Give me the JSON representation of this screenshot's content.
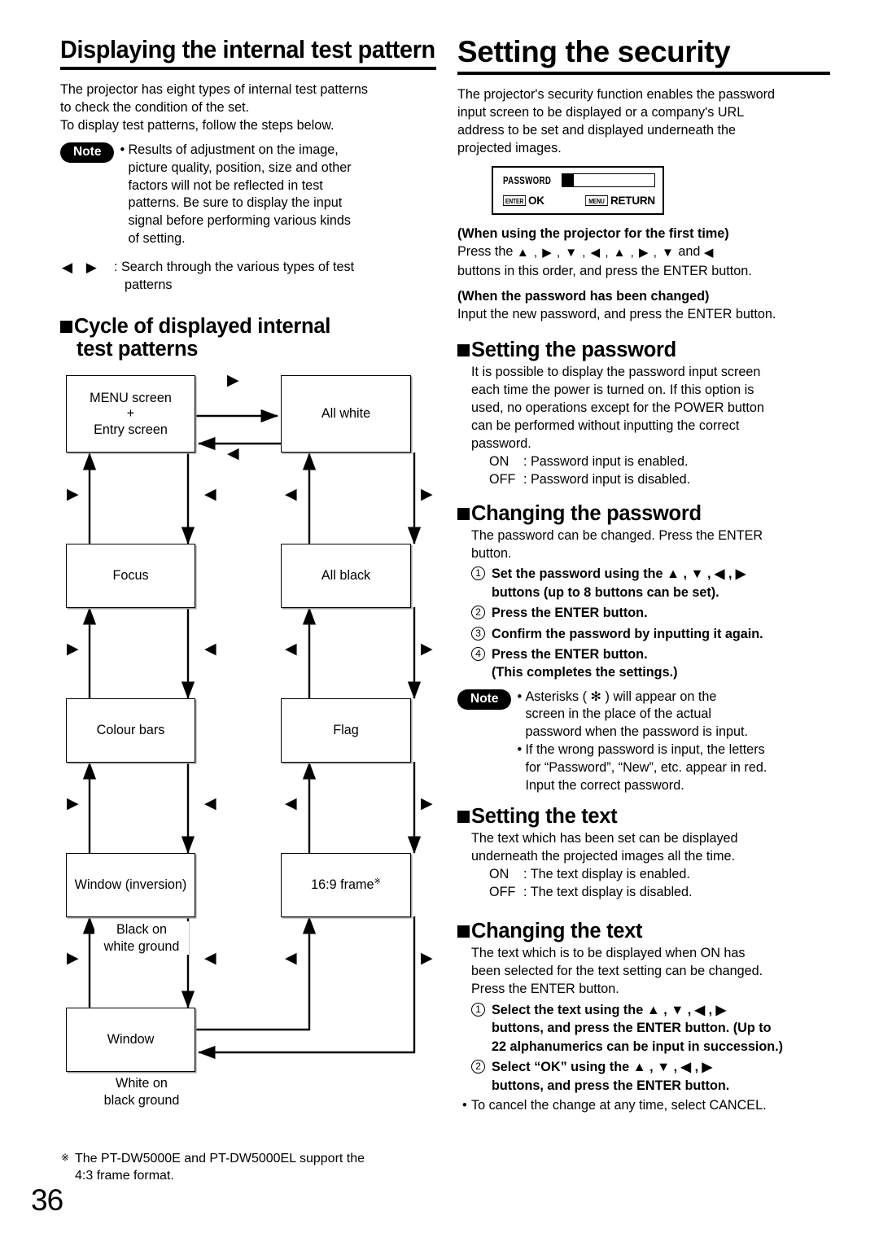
{
  "page_number": "36",
  "left_column": {
    "chapter_title": "Displaying the internal test pattern",
    "intro": [
      "The projector has eight types of internal test patterns",
      "to check the condition of the set.",
      "To display test patterns, follow the steps below."
    ],
    "note": {
      "badge": "Note",
      "bullet": "•",
      "items": [
        "Results of adjustment on the image,",
        "picture quality, position, size and other",
        "factors will not be reflected in test",
        "patterns. Be sure to display the input",
        "signal before performing various kinds",
        "of setting."
      ]
    },
    "legend": {
      "triangles": "◀ ▶",
      "line1": ": Search through the various types of test",
      "line2": "patterns"
    },
    "section_title_line1": "Cycle of displayed internal",
    "section_title_line2": "test patterns",
    "flow": {
      "boxes": [
        {
          "id": "menu",
          "label": "MENU screen\n+\nEntry screen"
        },
        {
          "id": "all-white",
          "label": "All white"
        },
        {
          "id": "focus",
          "label": "Focus"
        },
        {
          "id": "all-black",
          "label": "All black"
        },
        {
          "id": "colour-bars",
          "label": "Colour bars"
        },
        {
          "id": "flag",
          "label": "Flag"
        },
        {
          "id": "window-inversion",
          "label": "Window (inversion)"
        },
        {
          "id": "frame-16-9",
          "label": "16:9 frame",
          "sup": "※"
        },
        {
          "id": "window",
          "label": "Window"
        }
      ],
      "caption_black_on_white_l1": "Black on",
      "caption_black_on_white_l2": "white ground",
      "caption_white_on_black_l1": "White on",
      "caption_white_on_black_l2": "black ground",
      "tri_right": "▶",
      "tri_left": "◀"
    },
    "footnote": {
      "mark": "※",
      "line1": "The PT-DW5000E and PT-DW5000EL support the",
      "line2": "4:3 frame format."
    }
  },
  "right_column": {
    "chapter_title": "Setting the security",
    "intro": [
      "The projector's security function enables the password",
      "input screen to be displayed or a company's URL",
      "address to be set and displayed underneath the",
      "projected images."
    ],
    "osd": {
      "label": "PASSWORD",
      "enter_key": "ENTER",
      "enter_action": "OK",
      "menu_key": "MENU",
      "menu_action": "RETURN"
    },
    "first_time": {
      "heading": "(When using the projector for the first time)",
      "press_the": "Press the",
      "sequence": "▲ , ▶ , ▼ , ◀ , ▲ , ▶ , ▼",
      "and": "and",
      "last_button": "◀",
      "line2": "buttons in this order, and press the ENTER button."
    },
    "changed": {
      "heading": "(When the password has been changed)",
      "line1": "Input the new password, and press the ENTER button."
    },
    "setting_password": {
      "title": "Setting the password",
      "body": [
        "It is possible to display the password input screen",
        "each time the power is turned on. If this option is",
        "used, no operations except for the POWER button",
        "can be performed without inputting the correct",
        "password."
      ],
      "on_key": "ON",
      "on_val": ": Password input is enabled.",
      "off_key": "OFF",
      "off_val": ": Password input is disabled."
    },
    "changing_password": {
      "title": "Changing the password",
      "body": [
        "The password can be changed. Press the ENTER",
        "button."
      ],
      "steps": [
        {
          "num": "1",
          "line1": "Set the password using the ▲ , ▼ , ◀ , ▶",
          "line2": "buttons (up to 8 buttons can be set)."
        },
        {
          "num": "2",
          "line1": "Press the ENTER button.",
          "line2": ""
        },
        {
          "num": "3",
          "line1": "Confirm the password by inputting it again.",
          "line2": ""
        },
        {
          "num": "4",
          "line1": "Press the ENTER button.",
          "line2": "(This completes the settings.)"
        }
      ],
      "note": {
        "badge": "Note",
        "bullet": "•",
        "item1": [
          "Asterisks ( ✻ ) will appear on the",
          "screen in the place of the actual",
          "password when the password is input."
        ],
        "item2": [
          "If the wrong password is input, the letters",
          "for “Password”, “New”, etc. appear in red.",
          "Input the correct password."
        ]
      }
    },
    "setting_text": {
      "title": "Setting the text",
      "body": [
        "The text which has been set can be displayed",
        "underneath the projected images all the time."
      ],
      "on_key": "ON",
      "on_val": ": The text display is enabled.",
      "off_key": "OFF",
      "off_val": ": The text display is disabled."
    },
    "changing_text": {
      "title": "Changing the text",
      "body": [
        "The text which is to be displayed when ON has",
        "been selected for the text setting can be changed.",
        "Press the ENTER button."
      ],
      "steps": [
        {
          "num": "1",
          "line1": "Select the text using the ▲ , ▼ , ◀ , ▶",
          "line2": "buttons, and press the ENTER button. (Up to",
          "line3": "22 alphanumerics can be input in succession.)"
        },
        {
          "num": "2",
          "line1": "Select “OK” using the  ▲ , ▼ , ◀ , ▶",
          "line2": "buttons, and press the ENTER button.",
          "line3": ""
        }
      ],
      "cancel_bullet": "•",
      "cancel_note": "To cancel the change at any time, select CANCEL."
    }
  }
}
